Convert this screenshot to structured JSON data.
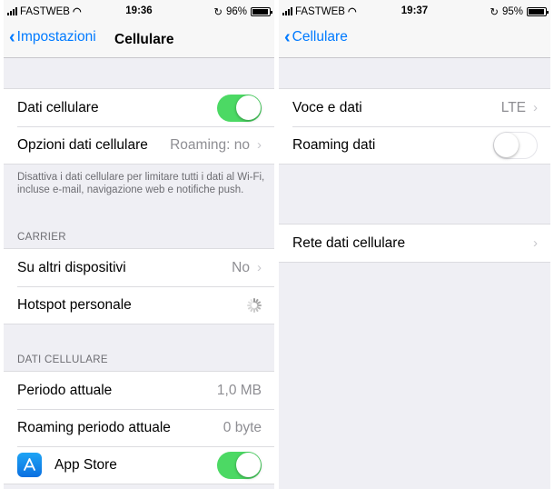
{
  "left": {
    "status": {
      "carrier": "FASTWEB",
      "time": "19:36",
      "battery": "96%"
    },
    "nav": {
      "back_label": "Impostazioni",
      "title": "Cellulare"
    },
    "rows": {
      "dati_cellulare": {
        "label": "Dati cellulare",
        "enabled": true
      },
      "opzioni": {
        "label": "Opzioni dati cellulare",
        "value": "Roaming: no"
      }
    },
    "note": "Disattiva i dati cellulare per limitare tutti i dati al Wi-Fi, incluse e-mail, navigazione web e notifiche push.",
    "carrier_section": {
      "header": "CARRIER",
      "altri": {
        "label": "Su altri dispositivi",
        "value": "No"
      },
      "hotspot": {
        "label": "Hotspot personale"
      }
    },
    "usage_section": {
      "header": "DATI CELLULARE",
      "periodo": {
        "label": "Periodo attuale",
        "value": "1,0 MB"
      },
      "roaming_periodo": {
        "label": "Roaming periodo attuale",
        "value": "0 byte"
      },
      "app_store": {
        "label": "App Store",
        "enabled": true,
        "icon": "app-store-icon"
      }
    }
  },
  "right": {
    "status": {
      "carrier": "FASTWEB",
      "time": "19:37",
      "battery": "95%"
    },
    "nav": {
      "back_label": "Cellulare"
    },
    "rows": {
      "voce": {
        "label": "Voce e dati",
        "value": "LTE"
      },
      "roaming": {
        "label": "Roaming dati",
        "enabled": false
      },
      "rete": {
        "label": "Rete dati cellulare"
      }
    }
  },
  "colors": {
    "accent": "#007aff",
    "toggle_on": "#4cd964",
    "background": "#efeff4"
  }
}
